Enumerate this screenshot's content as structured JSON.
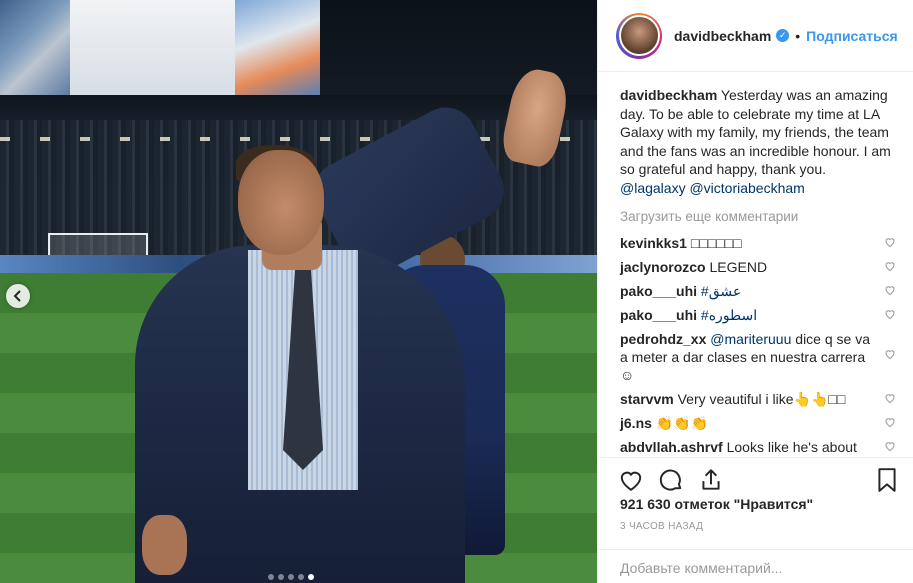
{
  "post": {
    "dots_count": 5,
    "active_dot": 4
  },
  "header": {
    "username": "davidbeckham",
    "separator": "•",
    "follow_label": "Подписаться",
    "verified_glyph": "✓"
  },
  "caption": {
    "username": "davidbeckham",
    "text": "Yesterday was an amazing day. To be able to celebrate my time at LA Galaxy with my family, my friends, the team and the fans was an incredible honour. I am so grateful and happy, thank you.",
    "mention_1": "@lagalaxy",
    "mention_2": "@victoriabeckham"
  },
  "load_more": "Загрузить еще комментарии",
  "comments": [
    {
      "username": "kevinkks1",
      "text": "□□□□□□"
    },
    {
      "username": "jaclynorozco",
      "text": "LEGEND"
    },
    {
      "username": "pako___uhi",
      "text": "#عشق"
    },
    {
      "username": "pako___uhi",
      "text": "#اسطوره"
    },
    {
      "username": "pedrohdz_xx",
      "mention": "@mariteruuu",
      "text": "dice q se va a meter a dar clases en nuestra carrera ☺"
    },
    {
      "username": "starvvm",
      "text": "Very veautiful i like👆👆□□"
    },
    {
      "username": "j6.ns",
      "text": "👏👏👏"
    },
    {
      "username": "abdvllah.ashrvf",
      "text": "Looks like he's about"
    }
  ],
  "likes": "921 630 отметок \"Нравится\"",
  "time_ago": "3 ЧАСОВ НАЗАД",
  "add_comment": {
    "placeholder": "Добавьте комментарий..."
  },
  "icons": {
    "carousel_prev": "chevron-left-icon",
    "like": "heart-icon",
    "comment": "comment-bubble-icon",
    "share": "share-icon",
    "save": "bookmark-icon",
    "comment_like": "small-heart-icon"
  },
  "colors": {
    "link": "#003569",
    "follow": "#3897f0",
    "muted": "#999999",
    "text": "#262626"
  }
}
